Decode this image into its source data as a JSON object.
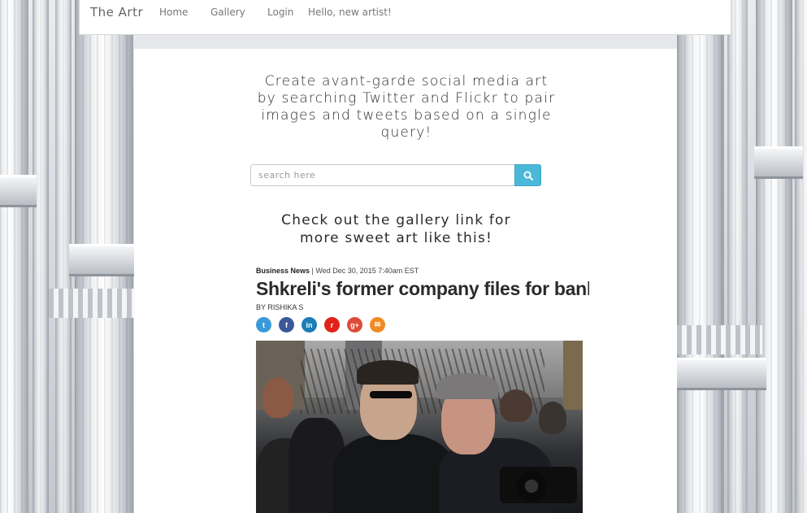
{
  "nav": {
    "brand": "The Artr",
    "links": [
      "Home",
      "Gallery",
      "Login"
    ],
    "greeting": "Hello, new artist!"
  },
  "hero": {
    "tagline": "Create avant-garde social media art by searching Twitter and Flickr to pair images and tweets based on a single query!",
    "search_placeholder": "search here",
    "gallery_note": "Check out the gallery link for more sweet art like this!"
  },
  "article": {
    "section": "Business News",
    "date": "| Wed Dec 30, 2015 7:40am EST",
    "headline": "Shkreli's former company files for bank",
    "byline": "BY RISHIKA S",
    "share_icons": [
      "twitter-icon",
      "facebook-icon",
      "linkedin-icon",
      "reddit-icon",
      "google-plus-icon",
      "email-icon"
    ],
    "share_glyphs": [
      "t",
      "f",
      "in",
      "r",
      "g+",
      "✉"
    ],
    "share_colors": [
      "#3a9ad9",
      "#3b5998",
      "#1c7db8",
      "#e2231a",
      "#dd4b39",
      "#f08a24"
    ]
  }
}
